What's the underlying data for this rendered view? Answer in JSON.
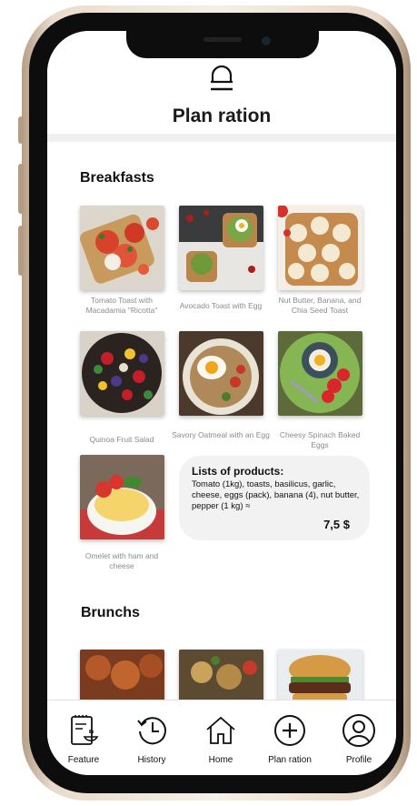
{
  "header": {
    "title": "Plan ration",
    "icon": "plan-ration-icon"
  },
  "sections": [
    {
      "title": "Breakfasts",
      "items": [
        {
          "caption": "Tomato Toast with Macadamia \"Ricotta\""
        },
        {
          "caption": "Avocado Toast with Egg"
        },
        {
          "caption": "Nut Butter, Banana, and Chia Seed Toast"
        },
        {
          "caption": "Quinoa Fruit Salad"
        },
        {
          "caption": "Savory Oatmeal with an Egg"
        },
        {
          "caption": "Cheesy Spinach Baked Eggs"
        },
        {
          "caption": "Omelet with ham and cheese"
        }
      ]
    },
    {
      "title": "Brunchs",
      "items": []
    }
  ],
  "products": {
    "title": "Lists of products:",
    "text": "Tomato (1kg), toasts, basilicus, garlic, cheese, eggs (pack), banana (4), nut butter, pepper (1 kg) ≈",
    "price": "7,5 $"
  },
  "tabs": [
    {
      "label": "Feature",
      "icon": "feature-icon"
    },
    {
      "label": "History",
      "icon": "history-icon"
    },
    {
      "label": "Home",
      "icon": "home-icon"
    },
    {
      "label": "Plan ration",
      "icon": "plus-circle-icon"
    },
    {
      "label": "Profile",
      "icon": "profile-icon"
    }
  ],
  "colors": {
    "accent": "#111111",
    "caption": "#8b8b8b",
    "card_bg": "#f2f2f2"
  }
}
